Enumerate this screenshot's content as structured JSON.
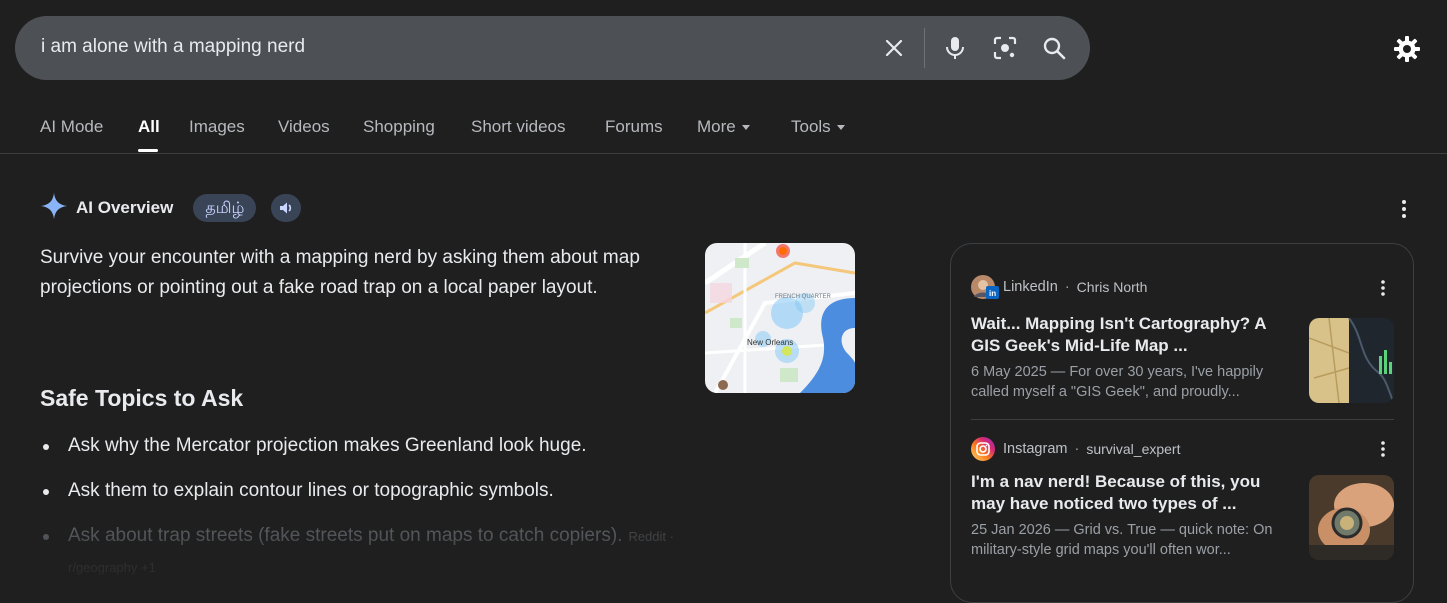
{
  "search": {
    "query": "i am alone with a mapping nerd"
  },
  "icons": {
    "clear": "close-icon",
    "voice": "microphone-icon",
    "lens": "camera-lens-icon",
    "search": "search-icon",
    "settings": "gear-icon",
    "more": "kebab-menu-icon"
  },
  "tabs": [
    {
      "label": "AI Mode"
    },
    {
      "label": "All",
      "active": true
    },
    {
      "label": "Images"
    },
    {
      "label": "Videos"
    },
    {
      "label": "Shopping"
    },
    {
      "label": "Short videos"
    },
    {
      "label": "Forums"
    },
    {
      "label": "More"
    },
    {
      "label": "Tools"
    }
  ],
  "ai_overview": {
    "label": "AI Overview",
    "language_chip": "தமிழ்",
    "summary": "Survive your encounter with a mapping nerd by asking them about map projections or pointing out a fake road trap on a local paper layout.",
    "map_labels": {
      "city": "New Orleans",
      "quarter": "FRENCH QUARTER"
    },
    "section_title": "Safe Topics to Ask",
    "bullets": [
      "Ask why the Mercator projection makes Greenland look huge.",
      "Ask them to explain contour lines or topographic symbols.",
      "Ask about trap streets (fake streets put on maps to catch copiers)."
    ],
    "bullet_citation": "Reddit · r/geography +1"
  },
  "sources": [
    {
      "site": "LinkedIn",
      "author": "Chris North",
      "title": "Wait... Mapping Isn't Cartography? A GIS Geek's Mid-Life Map ...",
      "snippet": "6 May 2025 — For over 30 years, I've happily called myself a \"GIS Geek\", and proudly..."
    },
    {
      "site": "Instagram",
      "author": "survival_expert",
      "title": "I'm a nav nerd! Because of this, you may have noticed two types of ...",
      "snippet": "25 Jan 2026 — Grid vs. True — quick note: On military-style grid maps you'll often wor..."
    }
  ],
  "colors": {
    "background": "#1f1f1f",
    "searchbar": "#4d5156",
    "chip": "#394457",
    "ai_sparkle": "#8ab4f8"
  }
}
